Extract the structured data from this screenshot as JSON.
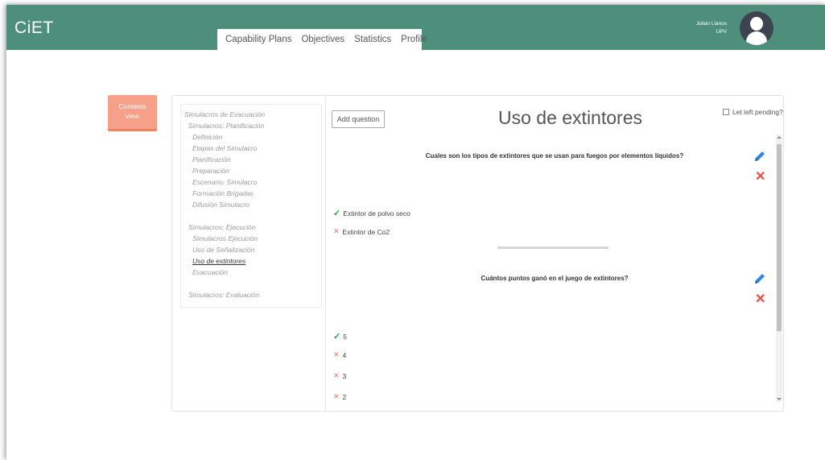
{
  "header": {
    "brand": "CiET",
    "tabs": [
      "Capability Plans",
      "Objectives",
      "Statistics",
      "Profile"
    ],
    "user": {
      "name": "Julian Llanos",
      "org": "UPV"
    }
  },
  "contents_button": {
    "line1": "Contents",
    "line2": "view"
  },
  "toc": [
    {
      "label": "Simulacros de Evacuación",
      "level": 1
    },
    {
      "label": "Simulacros: Planificación",
      "level": 2
    },
    {
      "label": "Definición",
      "level": 3
    },
    {
      "label": "Etapas del Simulacro",
      "level": 3
    },
    {
      "label": "Planificación",
      "level": 3
    },
    {
      "label": "Preparación",
      "level": 3
    },
    {
      "label": "Escenario: Simulacro",
      "level": 3
    },
    {
      "label": "Formación Brigadas",
      "level": 3
    },
    {
      "label": "Difusión Simulacro",
      "level": 3
    },
    {
      "label": "Simulacros: Ejecución",
      "level": 2
    },
    {
      "label": "Simulacros Ejecución",
      "level": 3
    },
    {
      "label": "Uso de Señalización",
      "level": 3
    },
    {
      "label": "Uso de extintores",
      "level": 3,
      "active": true
    },
    {
      "label": "Evacuación",
      "level": 3
    },
    {
      "label": "Simulacros: Evaluación",
      "level": 2
    }
  ],
  "main": {
    "add_question": "Add question",
    "title": "Uso de extintores",
    "pending_label": "Let left pending?",
    "questions": [
      {
        "text": "Cuales son los tipos de extintores que se usan para fuegos por elementos líquidos?",
        "answers": [
          {
            "text": "Extintor de polvo seco",
            "correct": true
          },
          {
            "text": "Extintor de Co2",
            "correct": false
          }
        ]
      },
      {
        "text": "Cuántos puntos ganó en el juego de extintores?",
        "answers": [
          {
            "text": "5",
            "correct": true
          },
          {
            "text": "4",
            "correct": false
          },
          {
            "text": "3",
            "correct": false
          },
          {
            "text": "2",
            "correct": false
          }
        ]
      }
    ]
  },
  "colors": {
    "header": "#4e8f7c",
    "accent": "#f6a08a",
    "correct": "#3a9e4a",
    "wrong": "#e74c3c",
    "edit": "#2e86de"
  },
  "icons": {
    "correct": "check-icon",
    "wrong": "cross-icon",
    "edit": "pencil-icon",
    "delete": "delete-icon"
  }
}
